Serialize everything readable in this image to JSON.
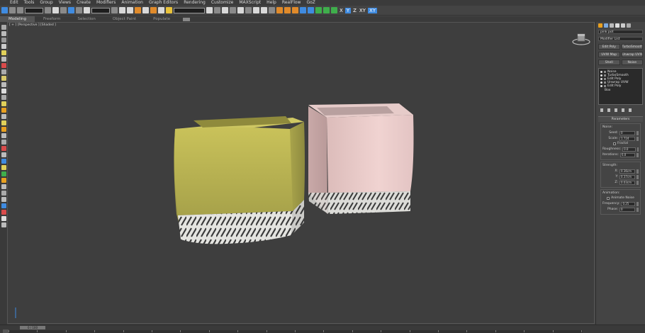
{
  "menu": {
    "items": [
      "Edit",
      "Tools",
      "Group",
      "Views",
      "Create",
      "Modifiers",
      "Animation",
      "Graph Editors",
      "Rendering",
      "Customize",
      "MAXScript",
      "Help",
      "RealFlow",
      "GoZ"
    ]
  },
  "toolbar": {
    "axis_x": "X",
    "axis_y": "Y",
    "axis_z": "Z",
    "axis_xy": "XY",
    "axis_xy2": "XY"
  },
  "ribbon": {
    "tabs": [
      "Modeling",
      "Freeform",
      "Selection",
      "Object Paint",
      "Populate"
    ],
    "active_tab": "Modeling"
  },
  "viewport": {
    "label": "[ + ] [Perspective ] [Shaded ]"
  },
  "command_panel": {
    "object_name": "pink pot",
    "modifier_list": "Modifier List",
    "buttons_row1": [
      "Edit Poly",
      "TurboSmooth"
    ],
    "buttons_row2": [
      "UVW Map",
      "Unwrap UVW"
    ],
    "buttons_row3": [
      "Shell",
      "Noise"
    ],
    "stack": [
      "Noise",
      "TurboSmooth",
      "Edit Poly",
      "Unwrap UVW",
      "Edit Poly"
    ],
    "stack_base": "Box",
    "parameters_title": "Parameters",
    "noise_group": {
      "label": "Noise:",
      "seed_label": "Seed:",
      "seed_value": "0",
      "scale_label": "Scale:",
      "scale_value": "1.724",
      "fractal_label": "Fractal",
      "roughness_label": "Roughness:",
      "roughness_value": "0.0",
      "iterations_label": "Iterations:",
      "iterations_value": "6.0"
    },
    "strength_group": {
      "label": "Strength:",
      "x_label": "X:",
      "x_value": "0.36cm",
      "y_label": "Y:",
      "y_value": "0.37cm",
      "z_label": "Z:",
      "z_value": "0.03cm"
    },
    "animation_group": {
      "label": "Animation:",
      "animate_label": "Animate Noise",
      "frequency_label": "Frequency:",
      "frequency_value": "0.25",
      "phase_label": "Phase:",
      "phase_value": "0"
    }
  },
  "status": {
    "time_slider": "0 / 100"
  },
  "colors": {
    "yellow_pot": "#b7b14f",
    "pink_pot": "#e9c8c6",
    "viewport_bg": "#3e3e3e",
    "accent_blue": "#3f8be0"
  }
}
